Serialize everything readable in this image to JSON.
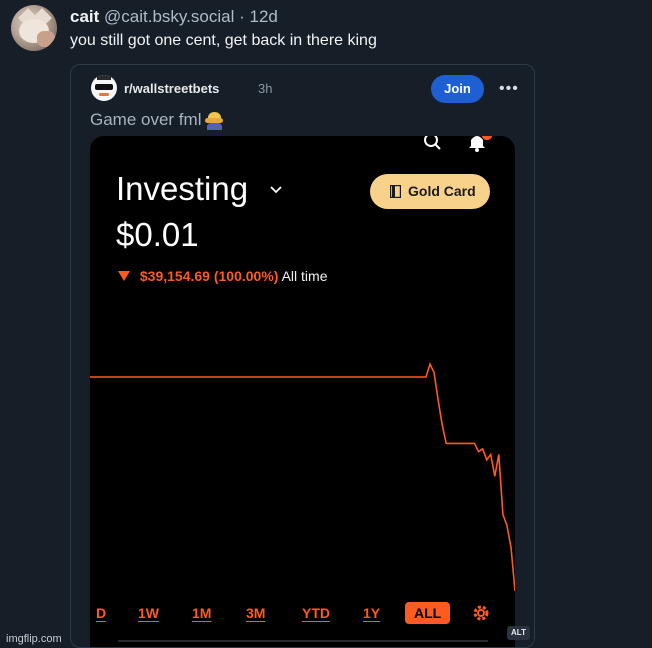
{
  "post": {
    "display_name": "cait",
    "handle": "@cait.bsky.social",
    "separator": "·",
    "age": "12d",
    "text": "you still got one cent, get back in there king",
    "alt_label": "ALT"
  },
  "embed": {
    "subreddit": "r/wallstreetbets",
    "time": "3h",
    "join_label": "Join",
    "more_label": "•••",
    "title": "Game over fml"
  },
  "phone": {
    "heading": "Investing",
    "gold_card_label": "Gold Card",
    "balance": "$0.01",
    "change_amount": "$39,154.69 (100.00%)",
    "change_period": "All time",
    "ranges": [
      "D",
      "1W",
      "1M",
      "3M",
      "YTD",
      "1Y",
      "ALL"
    ],
    "active_range": "ALL"
  },
  "colors": {
    "background": "#161e27",
    "accent_orange": "#ff5a1f",
    "gold": "#f8d18a",
    "join_blue": "#1e5fd3"
  },
  "chart_data": {
    "type": "line",
    "title": "",
    "xlabel": "",
    "ylabel": "",
    "note": "portfolio value line, flat then collapsing to near zero",
    "series": [
      {
        "values": [
          39154.69,
          39154.69,
          39154.69,
          39154.69,
          39154.69,
          39154.69,
          39154.69,
          39154.69,
          39154.69,
          39154.69,
          39154.69,
          39154.69,
          39154.69,
          39154.69,
          39154.69,
          39154.69,
          39154.69,
          39154.69,
          39154.69,
          39154.69,
          39154.69,
          39154.69,
          39154.69,
          39154.69,
          39154.69,
          39154.69,
          39154.69,
          39154.69,
          39154.69,
          39154.69,
          39154.69,
          39154.69,
          39154.69,
          39154.69,
          39154.69,
          39154.69,
          39154.69,
          39154.69,
          39154.69,
          39154.69,
          39154.69,
          39154.69,
          39154.69,
          39154.69,
          39154.69,
          39154.69,
          39154.69,
          39154.69,
          39154.69,
          39154.69,
          39154.69,
          39154.69,
          39154.69,
          39154.69,
          39154.69,
          39154.69,
          39154.69,
          39154.69,
          39154.69,
          39154.69,
          39154.69,
          39154.69,
          39154.69,
          39154.69,
          39154.69,
          39154.69,
          39154.69,
          39154.69,
          39154.69,
          39154.69,
          39154.69,
          39154.69,
          39154.69,
          39154.69,
          39154.69,
          39154.69,
          39154.69,
          39154.69,
          39154.69,
          39154.69,
          39154.69,
          39154.69,
          39154.69,
          39154.69,
          41500,
          40000,
          35000,
          30500,
          27000,
          27000,
          27000,
          27000,
          27000,
          27000,
          27000,
          27000,
          25500,
          26000,
          24000,
          25000,
          21000,
          25000,
          14000,
          12000,
          8000,
          0.01
        ]
      }
    ]
  }
}
